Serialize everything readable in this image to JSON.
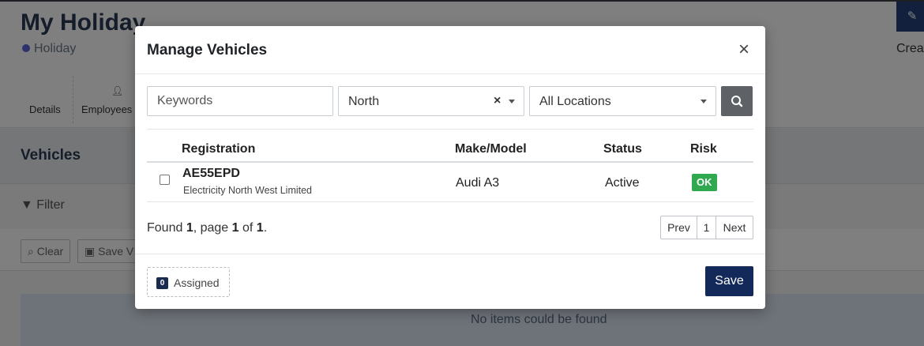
{
  "background": {
    "page_title": "My Holiday",
    "status_label": "Holiday",
    "create_label": "Creat",
    "tabs": [
      "Details",
      "Employees"
    ],
    "section_title": "Vehicles",
    "filter_label": "Filter",
    "clear_label": "Clear",
    "save_view_label": "Save V",
    "empty_text": "No items could be found"
  },
  "modal": {
    "title": "Manage Vehicles",
    "close_symbol": "×",
    "filters": {
      "keywords_placeholder": "Keywords",
      "region_value": "North",
      "region_clear_symbol": "×",
      "location_value": "All Locations"
    },
    "table": {
      "headers": [
        "Registration",
        "Make/Model",
        "Status",
        "Risk"
      ],
      "rows": [
        {
          "registration": "AE55EPD",
          "organisation": "Electricity North West Limited",
          "make_model": "Audi A3",
          "status": "Active",
          "risk": "OK"
        }
      ]
    },
    "results": {
      "prefix": "Found ",
      "count": "1",
      "page_text": ", page ",
      "page": "1",
      "of_text": " of ",
      "pages": "1",
      "suffix": "."
    },
    "pagination": {
      "prev_label": "Prev",
      "current_page": "1",
      "next_label": "Next"
    },
    "footer": {
      "assigned_count": "0",
      "assigned_label": "Assigned",
      "save_label": "Save"
    }
  },
  "colors": {
    "save_button": "#13295a",
    "risk_ok": "#2fa84f",
    "search_button": "#5e6266",
    "status_dot": "#5865d8"
  }
}
